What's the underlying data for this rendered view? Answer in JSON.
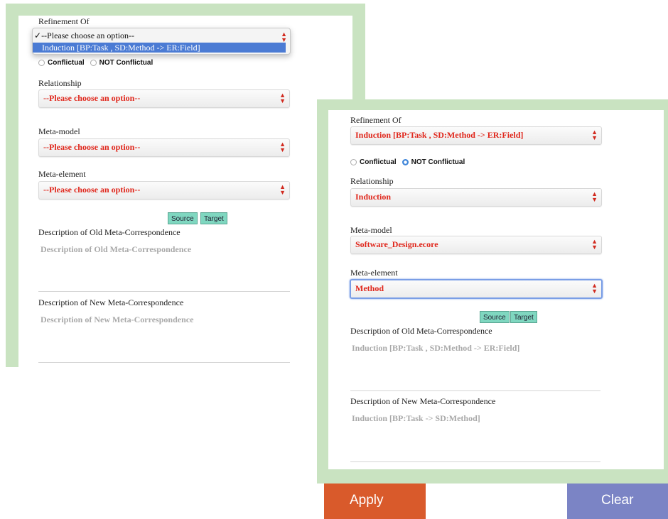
{
  "left_form": {
    "refinement_label": "Refinement Of",
    "refinement_dropdown": {
      "options": [
        "--Please choose an option--",
        "Induction [BP:Task , SD:Method -> ER:Field]"
      ],
      "checked_prefix": "✓"
    },
    "conflictual_label": "Conflictual",
    "not_conflictual_label": "NOT Conflictual",
    "relationship_label": "Relationship",
    "relationship_value": "--Please choose an option--",
    "meta_model_label": "Meta-model",
    "meta_model_value": "--Please choose an option--",
    "meta_element_label": "Meta-element",
    "meta_element_value": "--Please choose an option--",
    "source_button": "Source",
    "target_button": "Target",
    "old_desc_label": "Description of Old Meta-Correspondence",
    "old_desc_placeholder": "Description of Old Meta-Correspondence",
    "new_desc_label": "Description of New Meta-Correspondence",
    "new_desc_placeholder": "Description of New Meta-Correspondence"
  },
  "right_form": {
    "refinement_label": "Refinement Of",
    "refinement_value": "Induction [BP:Task , SD:Method -> ER:Field]",
    "conflictual_label": "Conflictual",
    "not_conflictual_label": "NOT Conflictual",
    "selected_radio": "NOT Conflictual",
    "relationship_label": "Relationship",
    "relationship_value": "Induction",
    "meta_model_label": "Meta-model",
    "meta_model_value": "Software_Design.ecore",
    "meta_element_label": "Meta-element",
    "meta_element_value": "Method",
    "source_button": "Source",
    "target_button": "Target",
    "old_desc_label": "Description of Old Meta-Correspondence",
    "old_desc_value": "Induction [BP:Task , SD:Method -> ER:Field]",
    "new_desc_label": "Description of New Meta-Correspondence",
    "new_desc_value": "Induction [BP:Task -> SD:Method]"
  },
  "actions": {
    "apply_label": "Apply",
    "clear_label": "Clear"
  },
  "colors": {
    "panel_green": "#c9e3c1",
    "select_text_red": "#e0271c",
    "apply_orange": "#d95a2b",
    "clear_blue": "#7b84c5",
    "button_teal": "#7fd7c0",
    "radio_selected_blue": "#3f86d9"
  },
  "icons": [
    "select-arrows-icon",
    "checkmark-icon",
    "radio-icon"
  ]
}
